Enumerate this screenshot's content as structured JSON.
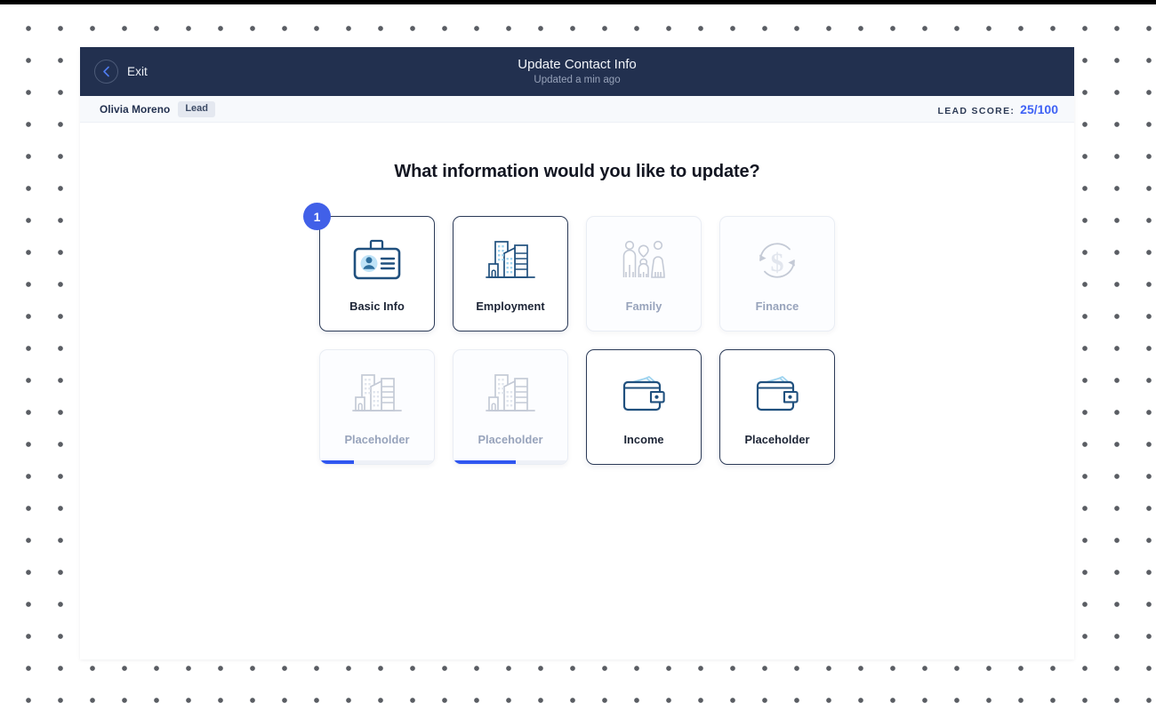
{
  "window": {
    "background_style": "dot-grid",
    "dot_color": "#5a5d63",
    "accent_color": "#3f62f5",
    "header_color": "#22304f"
  },
  "header": {
    "exit_label": "Exit",
    "back_icon": "chevron-left-icon",
    "title": "Update Contact Info",
    "subtitle": "Updated a min ago"
  },
  "sub_header": {
    "contact_name": "Olivia Moreno",
    "stage_badge": "Lead",
    "lead_score_label": "LEAD SCORE:",
    "lead_score_value": "25/100"
  },
  "main": {
    "question": "What information would you like to update?",
    "step_badge": "1",
    "cards": [
      {
        "label": "Basic Info",
        "icon": "id-badge-icon",
        "enabled": true,
        "progress": null
      },
      {
        "label": "Employment",
        "icon": "office-buildings-icon",
        "enabled": true,
        "progress": null
      },
      {
        "label": "Family",
        "icon": "family-icon",
        "enabled": false,
        "progress": null
      },
      {
        "label": "Finance",
        "icon": "dollar-refresh-icon",
        "enabled": false,
        "progress": null
      },
      {
        "label": "Placeholder",
        "icon": "office-buildings-icon",
        "enabled": false,
        "progress": 30
      },
      {
        "label": "Placeholder",
        "icon": "office-buildings-icon",
        "enabled": false,
        "progress": 55
      },
      {
        "label": "Income",
        "icon": "wallet-icon",
        "enabled": true,
        "progress": null
      },
      {
        "label": "Placeholder",
        "icon": "wallet-icon",
        "enabled": true,
        "progress": null
      }
    ]
  }
}
